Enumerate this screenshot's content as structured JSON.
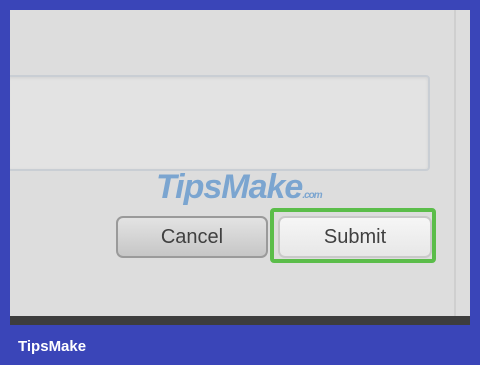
{
  "form": {
    "cancel_label": "Cancel",
    "submit_label": "Submit"
  },
  "watermark": {
    "text": "TipsMake",
    "domain": ".com"
  },
  "caption": "TipsMake",
  "colors": {
    "page_border": "#3a45b8",
    "highlight": "#5bbd4a"
  }
}
